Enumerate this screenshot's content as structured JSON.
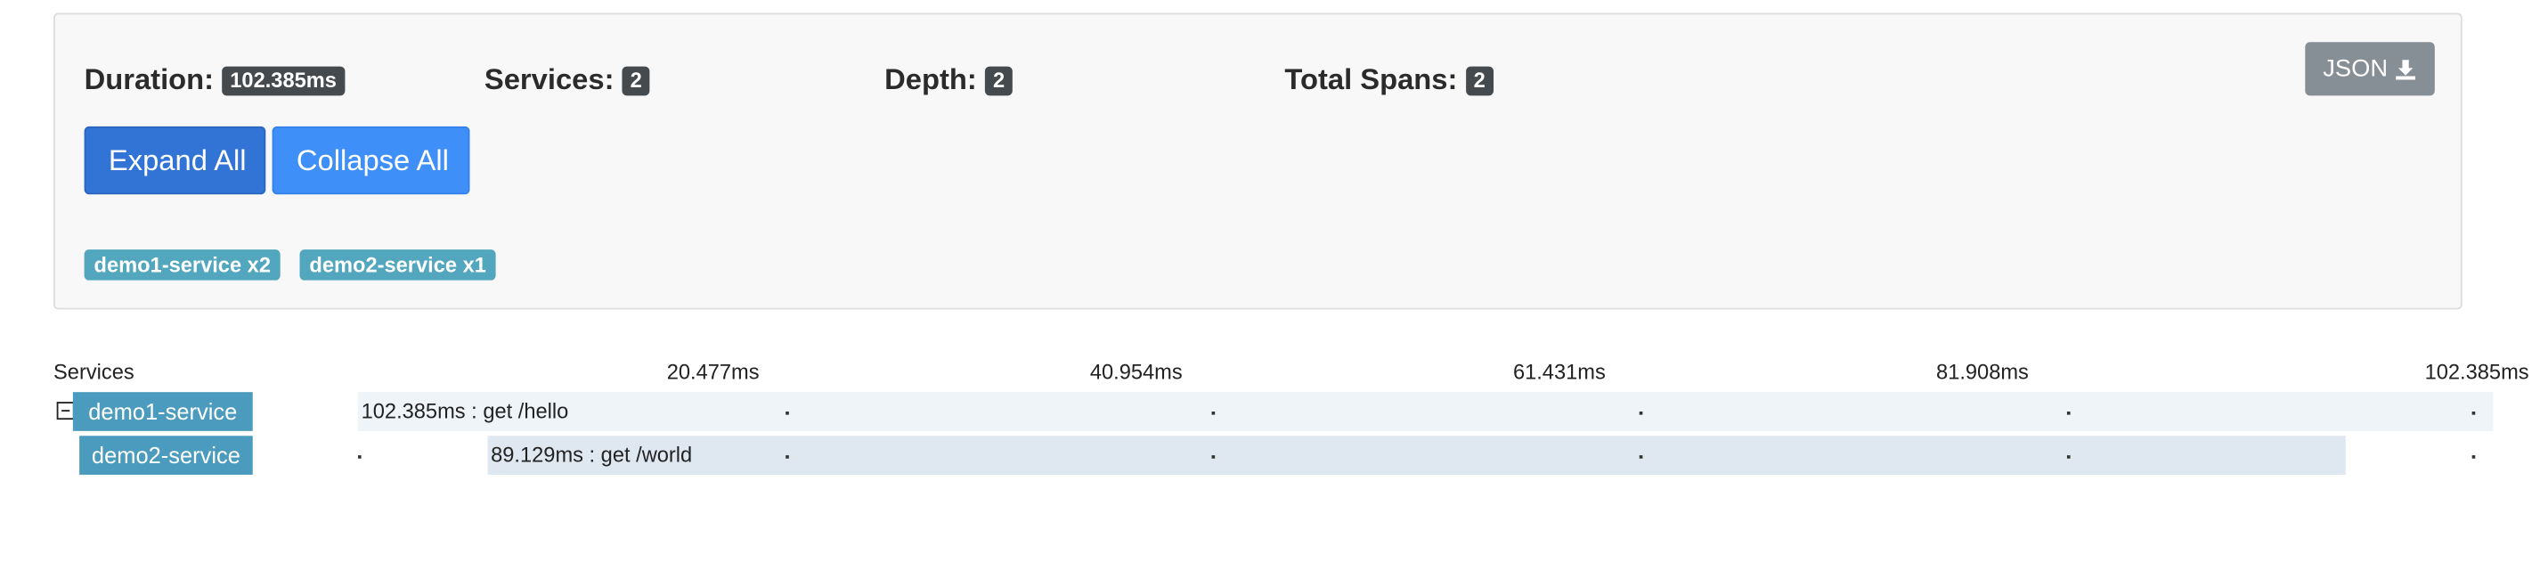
{
  "summary": {
    "duration_label": "Duration:",
    "duration_value": "102.385ms",
    "services_label": "Services:",
    "services_value": "2",
    "depth_label": "Depth:",
    "depth_value": "2",
    "total_spans_label": "Total Spans:",
    "total_spans_value": "2",
    "json_button_label": "JSON",
    "json_button_icon": "download-icon",
    "expand_all_label": "Expand All",
    "collapse_all_label": "Collapse All",
    "service_tags": [
      "demo1-service x2",
      "demo2-service x1"
    ]
  },
  "trace": {
    "services_header": "Services",
    "tick_labels": [
      "20.477ms",
      "40.954ms",
      "61.431ms",
      "81.908ms",
      "102.385ms"
    ],
    "total_duration_ms": 102.385,
    "rows": [
      {
        "service": "demo1-service",
        "toggle_icon": "collapse-minus-icon",
        "span_label": "102.385ms : get /hello",
        "start_ms": 0,
        "duration_ms": 102.385
      },
      {
        "service": "demo2-service",
        "span_label": "89.129ms : get /world",
        "start_ms": 6.6,
        "duration_ms": 89.129
      }
    ]
  },
  "colors": {
    "badge_dark": "#454a4f",
    "json_button": "#868e96",
    "expand_button": "#3174d6",
    "collapse_button": "#3e8ff7",
    "service_tag": "#52a6bd",
    "service_label": "#4a9bbd",
    "root_span": "#eff4f9",
    "child_span": "#dfe8f1"
  }
}
